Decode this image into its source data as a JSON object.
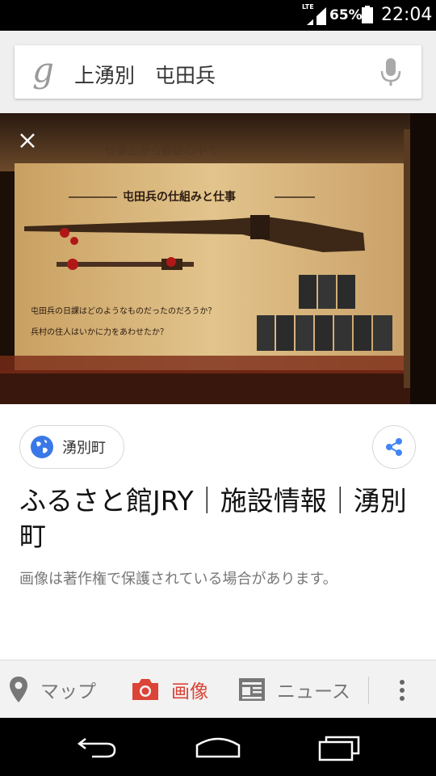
{
  "status_bar": {
    "network": "LTE",
    "battery_percent": "65%",
    "time": "22:04",
    "icons": [
      "signal-icon",
      "battery-icon"
    ]
  },
  "search": {
    "query": "上湧別　屯田兵",
    "logo_letter": "g",
    "icons": [
      "google-g-icon",
      "mic-icon"
    ]
  },
  "image_viewer": {
    "close_icon": "close-icon",
    "exhibit_panel_heading": "屯田兵の仕組みと仕事",
    "exhibit_top_text": "仕事生から郵便の中で",
    "exhibit_question_1": "屯田兵の日課はどのようなものだったのだろうか？",
    "exhibit_question_2": "兵村の住人はいかに力をあわせたか？"
  },
  "details": {
    "source_label": "湧別町",
    "title": "ふるさと館JRY｜施設情報｜湧別町",
    "copyright_note": "画像は著作権で保護されている場合があります。",
    "icons": [
      "globe-icon",
      "share-icon"
    ]
  },
  "tabs": [
    {
      "label": "マップ",
      "icon": "map-pin-icon",
      "active": false
    },
    {
      "label": "画像",
      "icon": "camera-icon",
      "active": true
    },
    {
      "label": "ニュース",
      "icon": "news-icon",
      "active": false
    }
  ],
  "colors": {
    "accent_red": "#db4437",
    "share_blue": "#4285f4",
    "globe_blue": "#3b78e7"
  },
  "nav_bar": {
    "icons": [
      "back-icon",
      "home-icon",
      "recents-icon"
    ]
  }
}
